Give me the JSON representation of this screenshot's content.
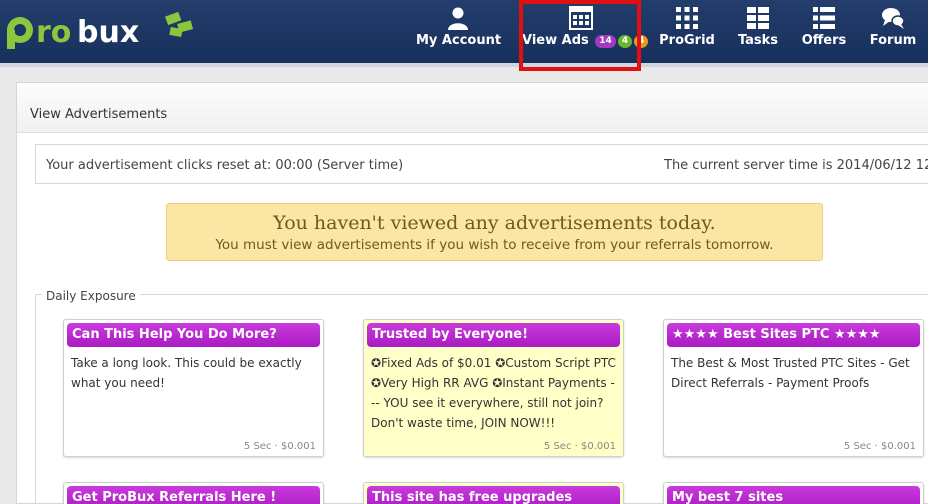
{
  "brand": {
    "name": "probux"
  },
  "nav": {
    "my_account": "My Account",
    "view_ads": "View Ads",
    "view_ads_badges": [
      "14",
      "4",
      "4"
    ],
    "progrid": "ProGrid",
    "tasks": "Tasks",
    "offers": "Offers",
    "forum": "Forum"
  },
  "colors": {
    "header": "#1c3562",
    "ad_title": "#b72dcf",
    "notice_bg": "#fbe6a4",
    "highlight": "#e01010",
    "badge_purple": "#a43ac3",
    "badge_green": "#6cb82b",
    "badge_orange": "#e79a1c"
  },
  "panel": {
    "title": "View Advertisements",
    "reset_text": "Your advertisement clicks reset at: 00:00 (Server time)",
    "server_time": "The current server time is 2014/06/12 12:",
    "notice_heading": "You haven't viewed any advertisements today.",
    "notice_sub": "You must view advertisements if you wish to receive from your referrals tomorrow.",
    "section_label": "Daily Exposure"
  },
  "ads": [
    {
      "title": "Can This Help You Do More?",
      "desc": "Take a long look. This could be exactly what you need!",
      "meta": "5 Sec · $0.001",
      "highlighted": false
    },
    {
      "title": "Trusted by Everyone!",
      "desc": "✪Fixed Ads of $0.01 ✪Custom Script PTC ✪Very High RR AVG ✪Instant Payments --- YOU see it everywhere, still not join? Don't waste time, JOIN NOW!!!",
      "meta": "5 Sec · $0.001",
      "highlighted": true
    },
    {
      "title": "★★★★ Best Sites PTC ★★★★",
      "desc": "The Best & Most Trusted PTC Sites - Get Direct Referrals - Payment Proofs",
      "meta": "5 Sec · $0.001",
      "highlighted": false
    },
    {
      "title": "Get ProBux Referrals Here !",
      "desc": "",
      "meta": "",
      "highlighted": false
    },
    {
      "title": "This site has free upgrades",
      "desc": "",
      "meta": "",
      "highlighted": true
    },
    {
      "title": "My best 7 sites",
      "desc": "",
      "meta": "",
      "highlighted": false
    }
  ]
}
